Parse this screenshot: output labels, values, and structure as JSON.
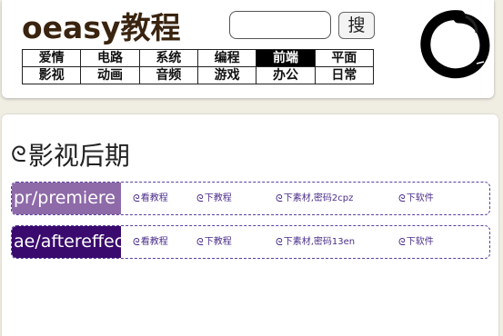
{
  "header": {
    "site_title": "oeasy教程",
    "search_placeholder": "",
    "search_button": "搜",
    "nav": [
      [
        "爱情",
        "电路",
        "系统",
        "编程",
        "前端",
        "平面"
      ],
      [
        "影视",
        "动画",
        "音频",
        "游戏",
        "办公",
        "日常"
      ]
    ],
    "active_nav": "前端"
  },
  "main": {
    "section_icon": "swirl-icon",
    "section_title": "影视后期",
    "rows": [
      {
        "name": "pr/premiere",
        "color": "#8e6aa8",
        "links": [
          "看教程",
          "下教程",
          "下素材,密码2cpz",
          "下软件"
        ]
      },
      {
        "name": "ae/aftereffects",
        "color": "#3a0a6e",
        "links": [
          "看教程",
          "下教程",
          "下素材,密码13en",
          "下软件"
        ]
      }
    ]
  },
  "colors": {
    "title": "#3a2410",
    "page_bg": "#f0ede3",
    "link": "#4a2d8a"
  }
}
